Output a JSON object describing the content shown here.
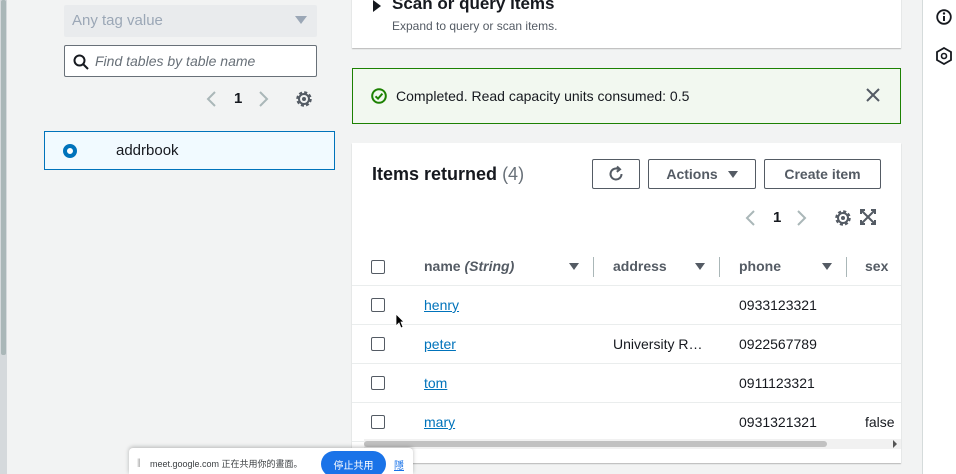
{
  "left_panel": {
    "tag_filter": {
      "value": "Any tag value"
    },
    "search": {
      "placeholder": "Find tables by table name",
      "value": ""
    },
    "pagination": {
      "current_page": "1"
    },
    "tables": [
      {
        "name": "addrbook",
        "selected": true
      }
    ]
  },
  "scan_section": {
    "title": "Scan or query items",
    "subtitle": "Expand to query or scan items."
  },
  "alert": {
    "message": "Completed. Read capacity units consumed: 0.5",
    "status_color": "#1d8102"
  },
  "items": {
    "title": "Items returned",
    "count": "(4)",
    "actions_label": "Actions",
    "create_label": "Create item",
    "pagination": {
      "current_page": "1"
    },
    "columns": [
      {
        "label": "name",
        "type": "(String)"
      },
      {
        "label": "address"
      },
      {
        "label": "phone"
      },
      {
        "label": "sex"
      }
    ],
    "rows": [
      {
        "name": "henry",
        "address": "",
        "phone": "0933123321",
        "sex": ""
      },
      {
        "name": "peter",
        "address": "University R…",
        "phone": "0922567789",
        "sex": ""
      },
      {
        "name": "tom",
        "address": "",
        "phone": "0911123321",
        "sex": ""
      },
      {
        "name": "mary",
        "address": "",
        "phone": "0931321321",
        "sex": "false"
      }
    ]
  },
  "share_bar": {
    "text": "meet.google.com 正在共用你的畫面。",
    "stop_label": "停止共用",
    "hide_label": "隱藏"
  },
  "colors": {
    "accent": "#0073bb",
    "success": "#1d8102",
    "meet_blue": "#1a73e8"
  }
}
